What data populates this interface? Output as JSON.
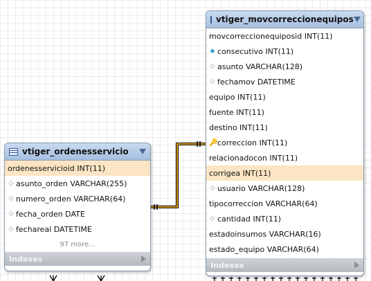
{
  "table_left": {
    "name": "vtiger_ordenesservicio",
    "columns": [
      {
        "text": "ordenesservicioid INT(11)",
        "icon": "none",
        "highlight": true
      },
      {
        "text": "asunto_orden VARCHAR(255)",
        "icon": "diamond-outline-icon"
      },
      {
        "text": "numero_orden VARCHAR(64)",
        "icon": "diamond-outline-icon"
      },
      {
        "text": "fecha_orden DATE",
        "icon": "diamond-outline-icon"
      },
      {
        "text": "fechareal DATETIME",
        "icon": "diamond-outline-icon"
      }
    ],
    "more": "97 more...",
    "indexes": "Indexes"
  },
  "table_right": {
    "name": "vtiger_movcorreccionequipos",
    "columns": [
      {
        "text": "movcorreccionequiposid INT(11)",
        "icon": "none"
      },
      {
        "text": "consecutivo INT(11)",
        "icon": "diamond-filled-icon"
      },
      {
        "text": "asunto VARCHAR(128)",
        "icon": "diamond-outline-icon"
      },
      {
        "text": "fechamov DATETIME",
        "icon": "diamond-outline-icon"
      },
      {
        "text": "equipo INT(11)",
        "icon": "none"
      },
      {
        "text": "fuente INT(11)",
        "icon": "none"
      },
      {
        "text": "destino INT(11)",
        "icon": "none"
      },
      {
        "text": "correccion INT(11)",
        "icon": "key-icon"
      },
      {
        "text": "relacionadocon INT(11)",
        "icon": "none"
      },
      {
        "text": "corrigea INT(11)",
        "icon": "none",
        "highlight": true
      },
      {
        "text": "usuario VARCHAR(128)",
        "icon": "diamond-outline-icon"
      },
      {
        "text": "tipocorreccion VARCHAR(64)",
        "icon": "none"
      },
      {
        "text": "cantidad INT(11)",
        "icon": "diamond-outline-icon"
      },
      {
        "text": "estadoinsumos VARCHAR(16)",
        "icon": "none"
      },
      {
        "text": "estado_equipo VARCHAR(64)",
        "icon": "none"
      }
    ],
    "indexes": "Indexes"
  },
  "colors": {
    "relationship": "#e0a020",
    "highlight": "#fce5c4",
    "header": "#b4cae6"
  }
}
